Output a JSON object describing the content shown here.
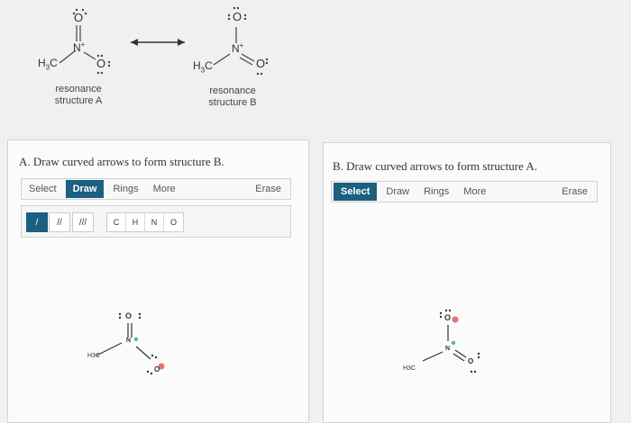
{
  "resonance": {
    "a": {
      "label": "resonance\nstructure A",
      "line1": "resonance",
      "line2": "structure A"
    },
    "b": {
      "line1": "resonance",
      "line2": "structure B"
    }
  },
  "mol": {
    "h3c": "H",
    "h3c_sub": "3",
    "h3c_c": "C",
    "n": "N",
    "plus": "+",
    "o": "O"
  },
  "panel_a": {
    "title": "A. Draw curved arrows to form structure B.",
    "toolbar": {
      "select": "Select",
      "draw": "Draw",
      "rings": "Rings",
      "more": "More",
      "erase": "Erase"
    },
    "tools": {
      "single": "/",
      "double": "//",
      "triple": "///"
    },
    "atoms": [
      "C",
      "H",
      "N",
      "O"
    ],
    "canvas": {
      "h3c": "H3C",
      "n": "N",
      "o": "O"
    }
  },
  "panel_b": {
    "title": "B. Draw curved arrows to form structure A.",
    "toolbar": {
      "select": "Select",
      "draw": "Draw",
      "rings": "Rings",
      "more": "More",
      "erase": "Erase"
    },
    "canvas": {
      "h3c": "H3C",
      "n": "N",
      "o": "O"
    }
  },
  "colors": {
    "accent": "#1d5f80",
    "negative_charge": "#e57373",
    "positive_charge": "#66bb6a"
  }
}
